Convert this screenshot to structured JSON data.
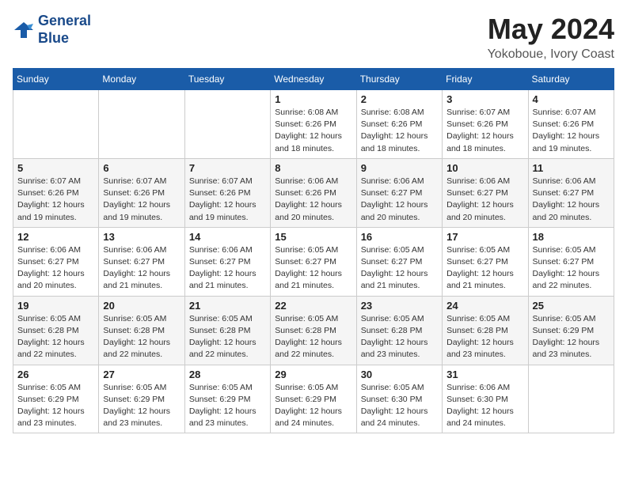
{
  "header": {
    "logo_line1": "General",
    "logo_line2": "Blue",
    "month": "May 2024",
    "location": "Yokoboue, Ivory Coast"
  },
  "weekdays": [
    "Sunday",
    "Monday",
    "Tuesday",
    "Wednesday",
    "Thursday",
    "Friday",
    "Saturday"
  ],
  "weeks": [
    [
      {
        "day": "",
        "info": ""
      },
      {
        "day": "",
        "info": ""
      },
      {
        "day": "",
        "info": ""
      },
      {
        "day": "1",
        "info": "Sunrise: 6:08 AM\nSunset: 6:26 PM\nDaylight: 12 hours\nand 18 minutes."
      },
      {
        "day": "2",
        "info": "Sunrise: 6:08 AM\nSunset: 6:26 PM\nDaylight: 12 hours\nand 18 minutes."
      },
      {
        "day": "3",
        "info": "Sunrise: 6:07 AM\nSunset: 6:26 PM\nDaylight: 12 hours\nand 18 minutes."
      },
      {
        "day": "4",
        "info": "Sunrise: 6:07 AM\nSunset: 6:26 PM\nDaylight: 12 hours\nand 19 minutes."
      }
    ],
    [
      {
        "day": "5",
        "info": "Sunrise: 6:07 AM\nSunset: 6:26 PM\nDaylight: 12 hours\nand 19 minutes."
      },
      {
        "day": "6",
        "info": "Sunrise: 6:07 AM\nSunset: 6:26 PM\nDaylight: 12 hours\nand 19 minutes."
      },
      {
        "day": "7",
        "info": "Sunrise: 6:07 AM\nSunset: 6:26 PM\nDaylight: 12 hours\nand 19 minutes."
      },
      {
        "day": "8",
        "info": "Sunrise: 6:06 AM\nSunset: 6:26 PM\nDaylight: 12 hours\nand 20 minutes."
      },
      {
        "day": "9",
        "info": "Sunrise: 6:06 AM\nSunset: 6:27 PM\nDaylight: 12 hours\nand 20 minutes."
      },
      {
        "day": "10",
        "info": "Sunrise: 6:06 AM\nSunset: 6:27 PM\nDaylight: 12 hours\nand 20 minutes."
      },
      {
        "day": "11",
        "info": "Sunrise: 6:06 AM\nSunset: 6:27 PM\nDaylight: 12 hours\nand 20 minutes."
      }
    ],
    [
      {
        "day": "12",
        "info": "Sunrise: 6:06 AM\nSunset: 6:27 PM\nDaylight: 12 hours\nand 20 minutes."
      },
      {
        "day": "13",
        "info": "Sunrise: 6:06 AM\nSunset: 6:27 PM\nDaylight: 12 hours\nand 21 minutes."
      },
      {
        "day": "14",
        "info": "Sunrise: 6:06 AM\nSunset: 6:27 PM\nDaylight: 12 hours\nand 21 minutes."
      },
      {
        "day": "15",
        "info": "Sunrise: 6:05 AM\nSunset: 6:27 PM\nDaylight: 12 hours\nand 21 minutes."
      },
      {
        "day": "16",
        "info": "Sunrise: 6:05 AM\nSunset: 6:27 PM\nDaylight: 12 hours\nand 21 minutes."
      },
      {
        "day": "17",
        "info": "Sunrise: 6:05 AM\nSunset: 6:27 PM\nDaylight: 12 hours\nand 21 minutes."
      },
      {
        "day": "18",
        "info": "Sunrise: 6:05 AM\nSunset: 6:27 PM\nDaylight: 12 hours\nand 22 minutes."
      }
    ],
    [
      {
        "day": "19",
        "info": "Sunrise: 6:05 AM\nSunset: 6:28 PM\nDaylight: 12 hours\nand 22 minutes."
      },
      {
        "day": "20",
        "info": "Sunrise: 6:05 AM\nSunset: 6:28 PM\nDaylight: 12 hours\nand 22 minutes."
      },
      {
        "day": "21",
        "info": "Sunrise: 6:05 AM\nSunset: 6:28 PM\nDaylight: 12 hours\nand 22 minutes."
      },
      {
        "day": "22",
        "info": "Sunrise: 6:05 AM\nSunset: 6:28 PM\nDaylight: 12 hours\nand 22 minutes."
      },
      {
        "day": "23",
        "info": "Sunrise: 6:05 AM\nSunset: 6:28 PM\nDaylight: 12 hours\nand 23 minutes."
      },
      {
        "day": "24",
        "info": "Sunrise: 6:05 AM\nSunset: 6:28 PM\nDaylight: 12 hours\nand 23 minutes."
      },
      {
        "day": "25",
        "info": "Sunrise: 6:05 AM\nSunset: 6:29 PM\nDaylight: 12 hours\nand 23 minutes."
      }
    ],
    [
      {
        "day": "26",
        "info": "Sunrise: 6:05 AM\nSunset: 6:29 PM\nDaylight: 12 hours\nand 23 minutes."
      },
      {
        "day": "27",
        "info": "Sunrise: 6:05 AM\nSunset: 6:29 PM\nDaylight: 12 hours\nand 23 minutes."
      },
      {
        "day": "28",
        "info": "Sunrise: 6:05 AM\nSunset: 6:29 PM\nDaylight: 12 hours\nand 23 minutes."
      },
      {
        "day": "29",
        "info": "Sunrise: 6:05 AM\nSunset: 6:29 PM\nDaylight: 12 hours\nand 24 minutes."
      },
      {
        "day": "30",
        "info": "Sunrise: 6:05 AM\nSunset: 6:30 PM\nDaylight: 12 hours\nand 24 minutes."
      },
      {
        "day": "31",
        "info": "Sunrise: 6:06 AM\nSunset: 6:30 PM\nDaylight: 12 hours\nand 24 minutes."
      },
      {
        "day": "",
        "info": ""
      }
    ]
  ]
}
